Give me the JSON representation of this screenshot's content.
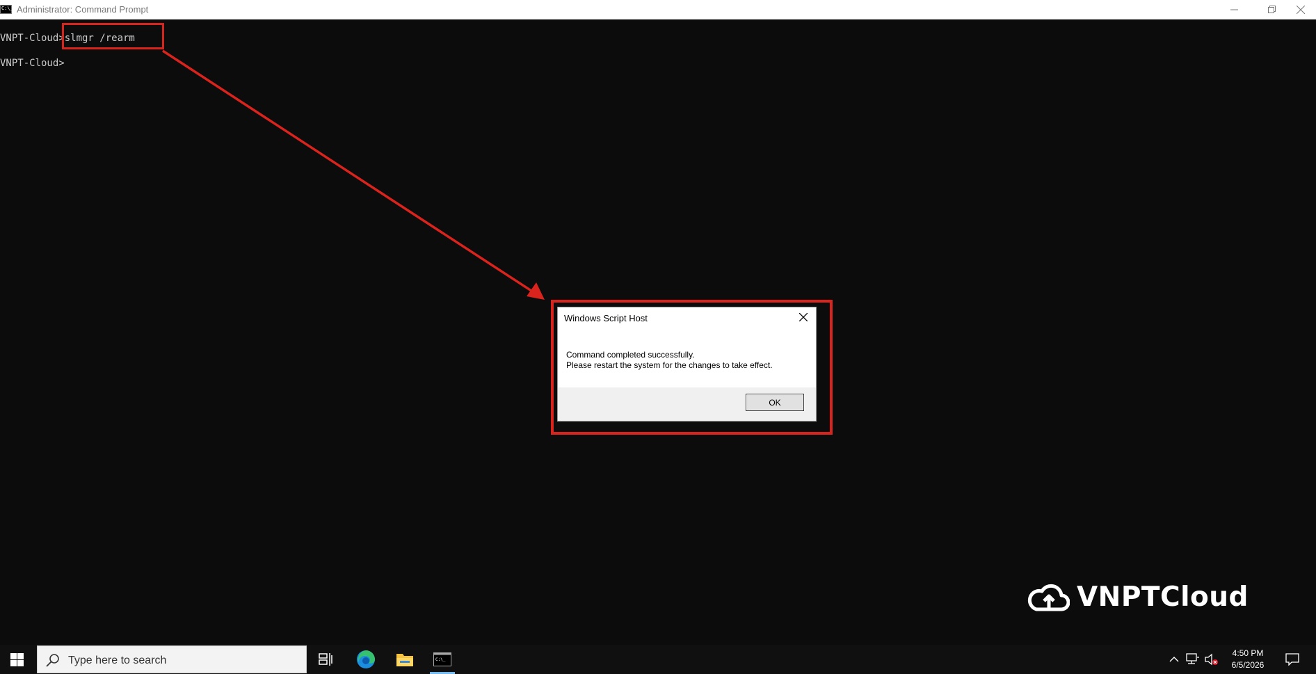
{
  "window": {
    "title": "Administrator: Command Prompt",
    "minimize_icon": "minimize-icon",
    "restore_icon": "restore-icon",
    "close_icon": "close-icon"
  },
  "console": {
    "lines": [
      "VNPT-Cloud>slmgr /rearm",
      "VNPT-Cloud>"
    ]
  },
  "dialog": {
    "title": "Windows Script Host",
    "message_line1": "Command completed successfully.",
    "message_line2": "Please restart the system for the changes to take effect.",
    "ok_label": "OK"
  },
  "annotation": {
    "color": "#d9231d"
  },
  "watermark": {
    "brand": "VNPTCloud"
  },
  "taskbar": {
    "search_placeholder": "Type here to search",
    "time": "4:50 PM",
    "date": "6/5/2026",
    "icons": [
      "windows-start-icon",
      "search-icon",
      "task-view-icon",
      "edge-icon",
      "file-explorer-icon",
      "command-prompt-icon",
      "chevron-up-icon",
      "network-icon",
      "speaker-muted-icon",
      "notification-icon"
    ]
  }
}
